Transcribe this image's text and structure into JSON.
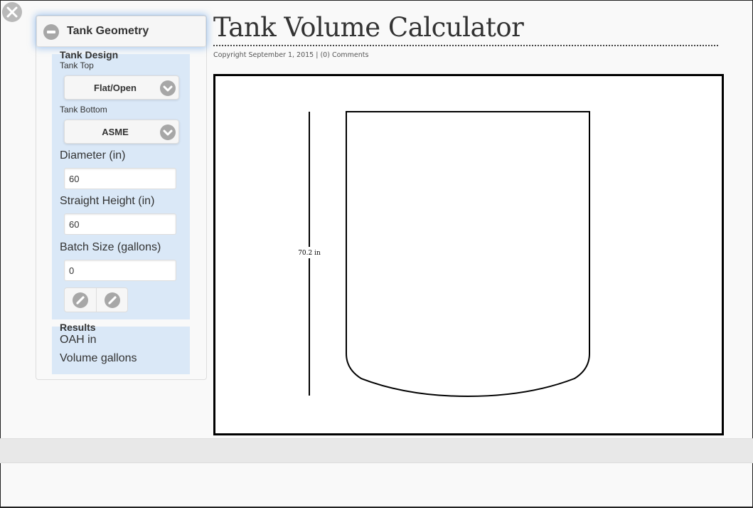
{
  "panel": {
    "header_title": "Tank Geometry",
    "design_section": {
      "title": "Tank Design",
      "tank_top_label": "Tank Top",
      "tank_top_value": "Flat/Open",
      "tank_bottom_label": "Tank Bottom",
      "tank_bottom_value": "ASME",
      "diameter_label": "Diameter (in)",
      "diameter_value": "60",
      "straight_height_label": "Straight Height (in)",
      "straight_height_value": "60",
      "batch_size_label": "Batch Size (gallons)",
      "batch_size_value": "0"
    },
    "results_section": {
      "title": "Results",
      "oah": "OAH in",
      "volume": "Volume gallons"
    }
  },
  "main": {
    "title": "Tank Volume Calculator",
    "meta": "Copyright September 1, 2015 | (0) Comments"
  },
  "drawing": {
    "height_label": "70.2 in"
  }
}
